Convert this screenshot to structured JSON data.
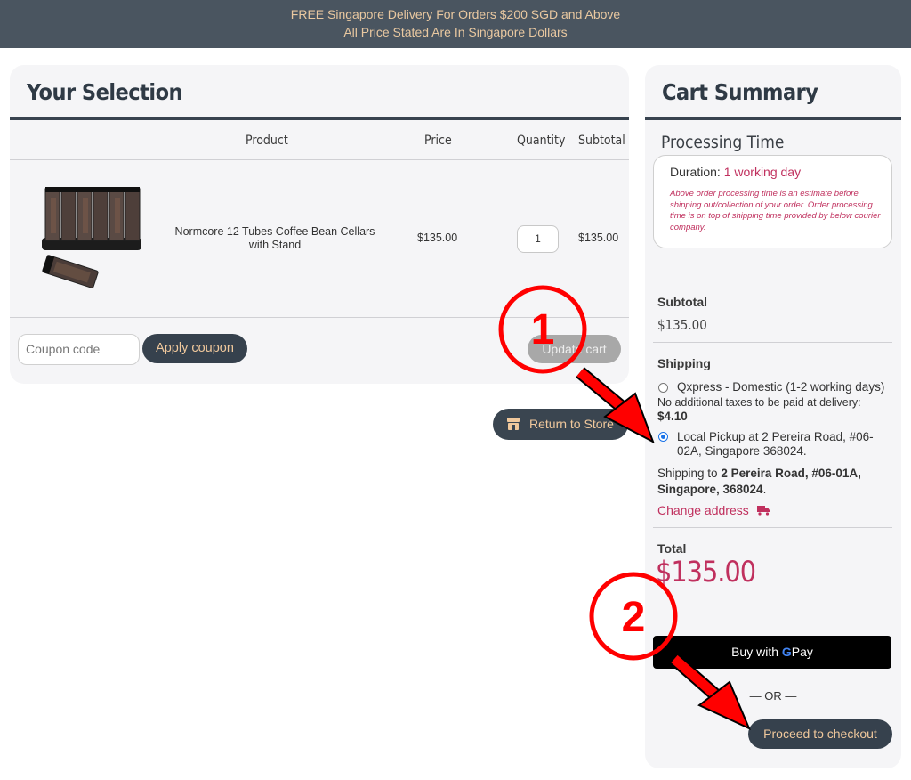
{
  "banner": {
    "line1": "FREE Singapore Delivery For Orders $200 SGD and Above",
    "line2": "All Price Stated Are In Singapore Dollars"
  },
  "selection": {
    "title": "Your Selection",
    "columns": {
      "product": "Product",
      "price": "Price",
      "quantity": "Quantity",
      "subtotal": "Subtotal"
    },
    "item": {
      "name": "Normcore 12 Tubes Coffee Bean Cellars with Stand",
      "price": "$135.00",
      "quantity": "1",
      "subtotal": "$135.00"
    },
    "coupon_placeholder": "Coupon code",
    "apply_label": "Apply coupon",
    "update_label": "Update cart",
    "return_label": "Return to Store"
  },
  "summary": {
    "title": "Cart Summary",
    "processing_title": "Processing Time",
    "duration_label": "Duration:",
    "duration_value": "1 working day",
    "note": "Above order processing time is an estimate before shipping out/collection of your order. Order processing time is on top of shipping time provided by below courier company.",
    "subtotal_label": "Subtotal",
    "subtotal_value": "$135.00",
    "shipping_label": "Shipping",
    "option1": "Qxpress - Domestic (1-2 working days)",
    "option1_tax": "No additional taxes to be paid at delivery:",
    "option1_price": "$4.10",
    "option2": "Local Pickup at 2 Pereira Road, #06-02A, Singapore 368024.",
    "ship_to_prefix": "Shipping to",
    "ship_to_address": "2 Pereira Road, #06-01A, Singapore, 368024",
    "ship_to_suffix": ".",
    "change_address": "Change address",
    "total_label": "Total",
    "total_value": "$135.00",
    "gpay_prefix": "Buy with",
    "gpay_g": "G",
    "gpay_pay": "Pay",
    "or_label": "— OR —",
    "checkout_label": "Proceed to checkout"
  },
  "annotations": {
    "step1": "1",
    "step2": "2"
  },
  "colors": {
    "accent": "#c0305e",
    "dark": "#36414d",
    "banner": "#4a5560",
    "annotation": "#ff0000"
  }
}
